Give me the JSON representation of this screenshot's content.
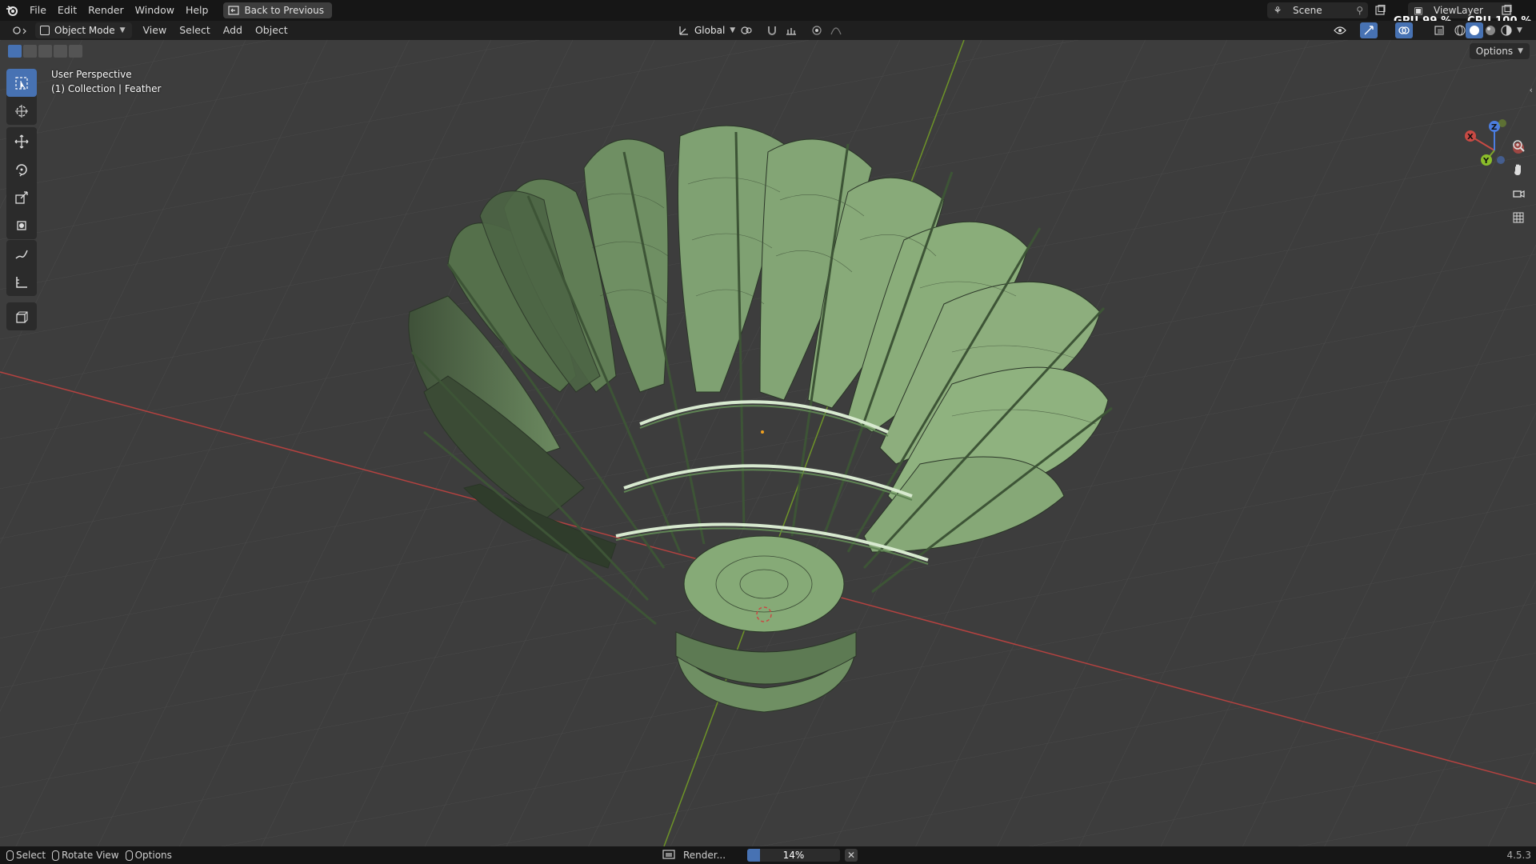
{
  "app": {
    "menus": [
      "File",
      "Edit",
      "Render",
      "Window",
      "Help"
    ],
    "back_button": "Back to Previous",
    "scene_name": "Scene",
    "view_layer": "ViewLayer",
    "gpu_label": "GPU 99 %",
    "cpu_label": "CPU 100 %"
  },
  "header": {
    "mode": "Object Mode",
    "menus": [
      "View",
      "Select",
      "Add",
      "Object"
    ],
    "transform_orientation": "Global",
    "options_label": "Options"
  },
  "viewport": {
    "perspective_label": "User Perspective",
    "collection_label": "(1) Collection | Feather",
    "axis_x": "X",
    "axis_y": "Y",
    "axis_z": "Z",
    "mesh_color": "#8fb27f",
    "x_axis_color": "#c8453f",
    "y_axis_color": "#7da42b"
  },
  "toolbar": {
    "tools": [
      "select-box-icon",
      "cursor-icon",
      "move-icon",
      "rotate-icon",
      "scale-icon",
      "transform-icon",
      "annotate-icon",
      "measure-icon",
      "add-cube-icon"
    ]
  },
  "statusbar": {
    "hint_select": "Select",
    "hint_rotate": "Rotate View",
    "hint_options": "Options",
    "render_label": "Render...",
    "render_progress": 14,
    "render_progress_text": "14%",
    "version": "4.5.3"
  }
}
